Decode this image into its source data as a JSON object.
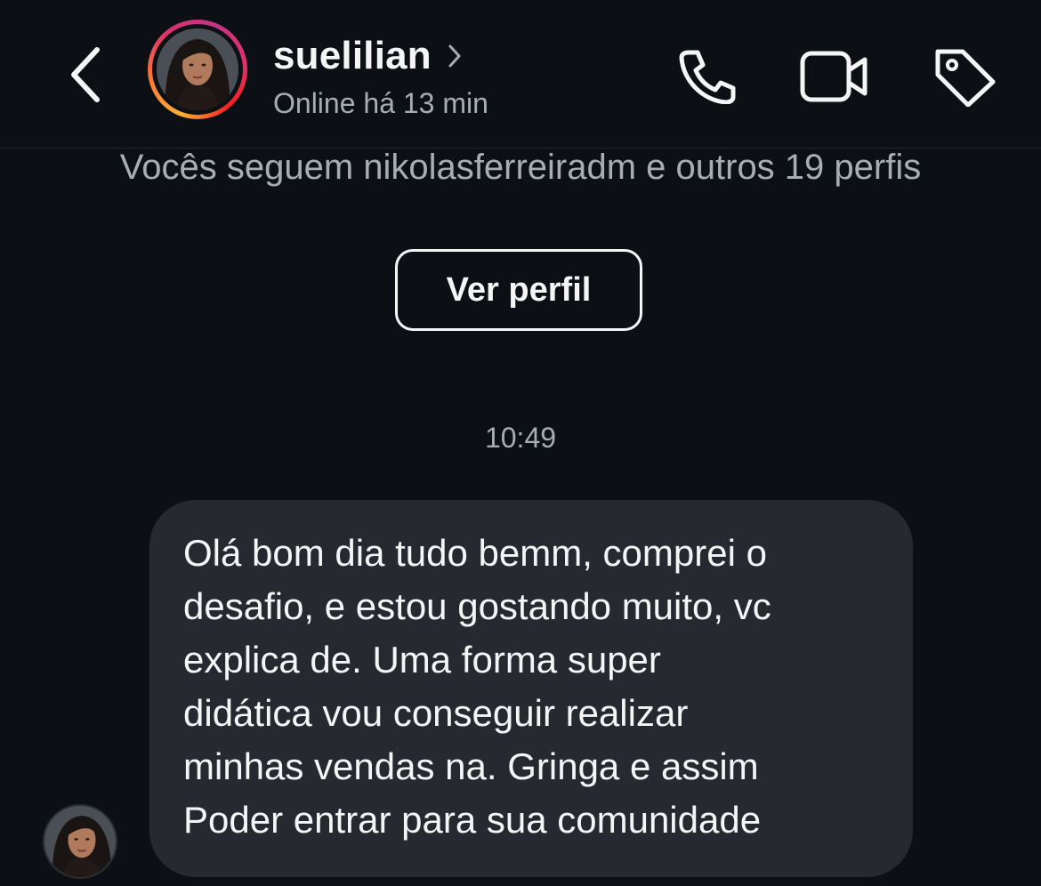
{
  "header": {
    "username": "suelilian",
    "status": "Online há 13 min",
    "icons": {
      "back": "chevron-left-icon",
      "name_chevron": "chevron-right-icon",
      "call": "phone-icon",
      "video": "video-camera-icon",
      "tag": "tag-icon"
    }
  },
  "profile_card": {
    "mutual_followers": "Vocês seguem nikolasferreiradm e outros 19 perfis",
    "view_profile_label": "Ver perfil"
  },
  "conversation": {
    "timestamp": "10:49",
    "messages": [
      {
        "lines": [
          "Olá bom dia tudo bemm, comprei o",
          "desafio, e estou gostando muito, vc",
          "explica de. Uma forma super",
          "didática vou conseguir realizar",
          "minhas vendas na. Gringa e assim",
          "Poder entrar para sua comunidade"
        ]
      }
    ]
  },
  "colors": {
    "background": "#0c1014",
    "bubble": "#262a30",
    "text_primary": "#f5f5f5",
    "text_secondary": "#a8adb4",
    "story_ring": [
      "#fbb034",
      "#e1306c",
      "#c13584"
    ]
  }
}
